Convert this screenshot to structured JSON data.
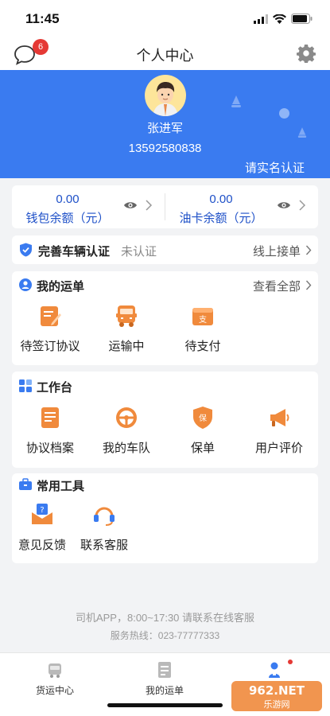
{
  "status_bar": {
    "time": "11:45"
  },
  "nav": {
    "title": "个人中心",
    "message_badge": "6"
  },
  "profile": {
    "name": "张进军",
    "phone": "13592580838",
    "verify_link": "请实名认证"
  },
  "balances": [
    {
      "value": "0.00",
      "label": "钱包余额（元）"
    },
    {
      "value": "0.00",
      "label": "油卡余额（元）"
    }
  ],
  "vehicle": {
    "title": "完善车辆认证",
    "status": "未认证",
    "action": "线上接单"
  },
  "orders": {
    "title": "我的运单",
    "more": "查看全部",
    "items": [
      {
        "label": "待签订协议",
        "icon": "contract-edit-icon"
      },
      {
        "label": "运输中",
        "icon": "truck-icon"
      },
      {
        "label": "待支付",
        "icon": "payment-wallet-icon"
      }
    ]
  },
  "workbench": {
    "title": "工作台",
    "items": [
      {
        "label": "协议档案",
        "icon": "agreement-file-icon"
      },
      {
        "label": "我的车队",
        "icon": "steering-wheel-icon"
      },
      {
        "label": "保单",
        "icon": "insurance-shield-icon"
      },
      {
        "label": "用户评价",
        "icon": "megaphone-icon"
      }
    ]
  },
  "tools": {
    "title": "常用工具",
    "items": [
      {
        "label": "意见反馈",
        "icon": "feedback-envelope-icon"
      },
      {
        "label": "联系客服",
        "icon": "headset-icon"
      }
    ]
  },
  "footer": {
    "note": "司机APP，8:00~17:30 请联系在线客服",
    "hotline": "服务热线：023-77777333"
  },
  "tabs": [
    {
      "label": "货运中心"
    },
    {
      "label": "我的运单"
    },
    {
      "label": ""
    }
  ],
  "watermark": {
    "text_top": "962.NET",
    "text_bottom": "乐游网"
  },
  "colors": {
    "primary": "#3a7bf0",
    "accent_orange": "#f08a3c",
    "badge_red": "#e53935",
    "balance_text": "#1e50c8"
  }
}
